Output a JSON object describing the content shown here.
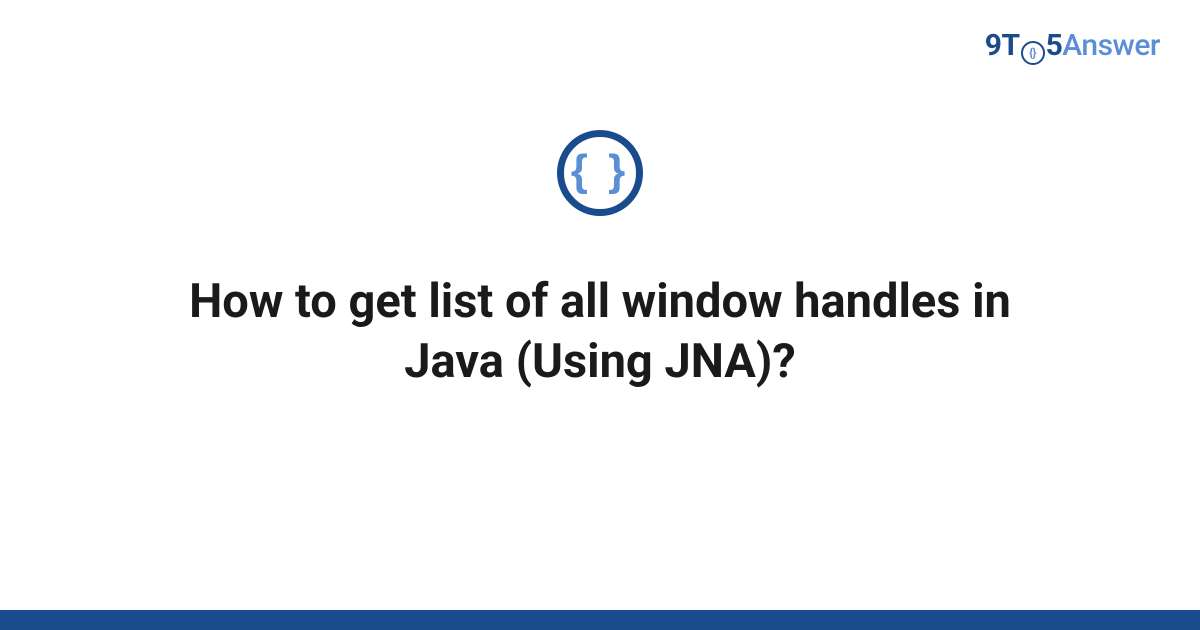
{
  "logo": {
    "part1": "9T",
    "part_o_inner": "{}",
    "part2": "5",
    "part3": "Answer"
  },
  "icon": {
    "braces": "{ }"
  },
  "title": "How to get list of all window handles in Java (Using JNA)?",
  "colors": {
    "primary": "#1a4b8c",
    "accent": "#5a8fd6"
  }
}
